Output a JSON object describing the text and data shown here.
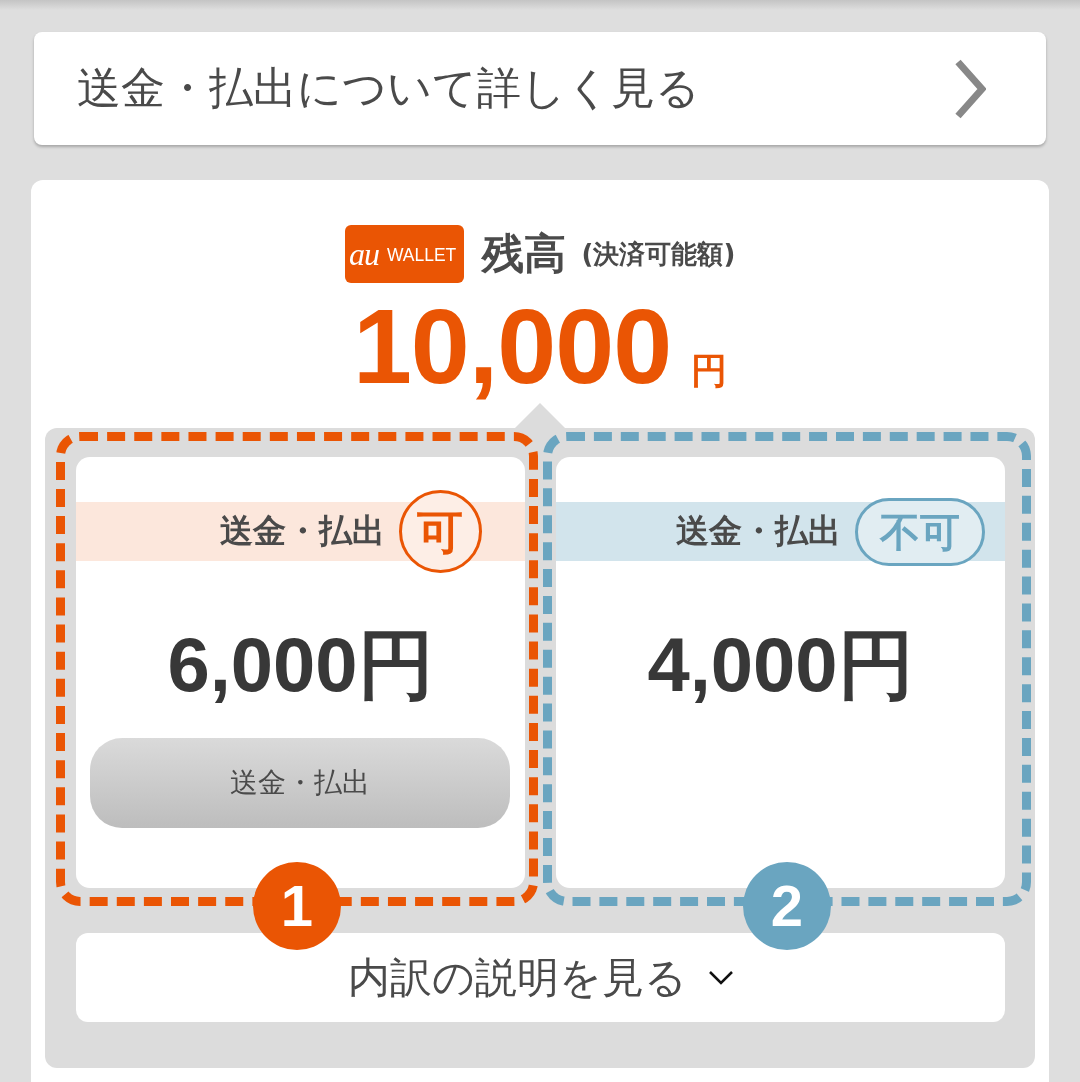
{
  "details_link": {
    "label": "送金・払出について詳しく見る"
  },
  "balance": {
    "logo": {
      "mark": "au",
      "name": "WALLET"
    },
    "title": "残高",
    "subtitle": "(決済可能額)",
    "amount": "10,000",
    "unit": "円"
  },
  "wallets": [
    {
      "number": "1",
      "color": "#ea5504",
      "header": "送金・払出",
      "badge": "可",
      "amount": "6,000円",
      "button": "送金・払出"
    },
    {
      "number": "2",
      "color": "#6aa5c0",
      "header": "送金・払出",
      "badge": "不可",
      "amount": "4,000円"
    }
  ],
  "breakdown_toggle": {
    "label": "内訳の説明を見る",
    "expanded": false
  }
}
